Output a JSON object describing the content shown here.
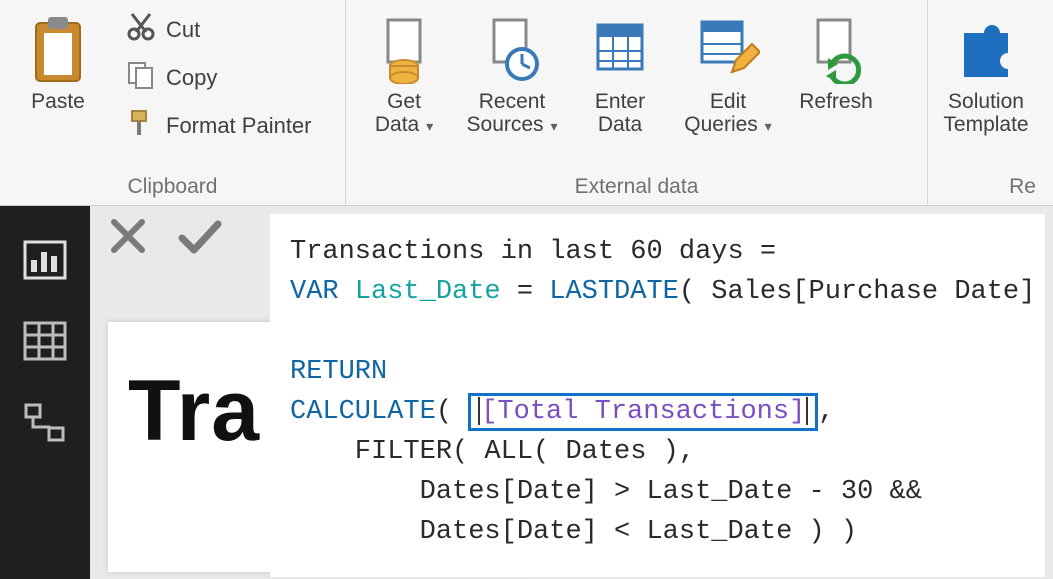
{
  "ribbon": {
    "clipboard": {
      "label": "Clipboard",
      "paste": "Paste",
      "cut": "Cut",
      "copy": "Copy",
      "format_painter": "Format Painter"
    },
    "external": {
      "label": "External data",
      "get_data": "Get\nData",
      "recent_sources": "Recent\nSources",
      "enter_data": "Enter\nData",
      "edit_queries": "Edit\nQueries",
      "refresh": "Refresh"
    },
    "resources": {
      "label": "Re",
      "solution_templates": "Solution\nTemplate"
    }
  },
  "canvas": {
    "card_text": "Tra"
  },
  "dax": {
    "line1_a": "Transactions in last 60 days =",
    "var_kw": "VAR",
    "var_name": "Last_Date",
    "eq": " = ",
    "lastdate_fn": "LASTDATE",
    "lastdate_arg": "( Sales[Purchase Date] )",
    "return_kw": "RETURN",
    "calculate_fn": "CALCULATE",
    "calc_open": "( ",
    "measure": "[Total Transactions]",
    "calc_after": ",",
    "filter_line": "    FILTER( ALL( Dates ),",
    "cond1": "        Dates[Date] > Last_Date - 30 &&",
    "cond2": "        Dates[Date] < Last_Date ) )"
  }
}
